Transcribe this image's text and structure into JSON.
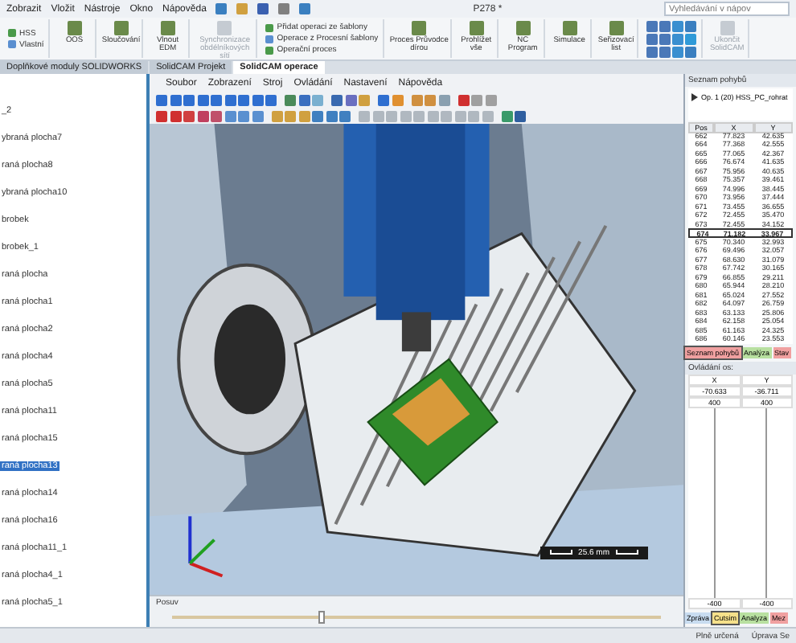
{
  "menu": [
    "Zobrazit",
    "Vložit",
    "Nástroje",
    "Okno",
    "Nápověda"
  ],
  "document_title": "P278 *",
  "help_search": {
    "placeholder": "Vyhledávání v nápov"
  },
  "ribbon": [
    {
      "kind": "stack",
      "items": [
        "HSS",
        "Vlastní"
      ]
    },
    {
      "kind": "large",
      "label": "OOS",
      "disabled": false
    },
    {
      "kind": "large",
      "label": "Sloučování",
      "disabled": false
    },
    {
      "kind": "large",
      "label": "Vlnout EDM",
      "disabled": false
    },
    {
      "kind": "large",
      "label": "Synchronizace obdélníkových sítí",
      "disabled": true
    },
    {
      "kind": "stack",
      "items": [
        "Přidat operaci ze šablony",
        "Operace z Procesní šablony",
        "Operační proces"
      ]
    },
    {
      "kind": "large",
      "label": "Proces Průvodce dírou",
      "disabled": false
    },
    {
      "kind": "large",
      "label": "Prohlížet vše",
      "disabled": false
    },
    {
      "kind": "large",
      "label": "NC Program",
      "disabled": false
    },
    {
      "kind": "large",
      "label": "Simulace",
      "disabled": false
    },
    {
      "kind": "large",
      "label": "Seřizovací list",
      "disabled": false
    },
    {
      "kind": "grid"
    },
    {
      "kind": "large",
      "label": "Ukončit SolidCAM",
      "disabled": true
    }
  ],
  "tabs": [
    {
      "label": "Doplňkové moduly SOLIDWORKS",
      "selected": false
    },
    {
      "label": "SolidCAM Projekt",
      "selected": false
    },
    {
      "label": "SolidCAM operace",
      "selected": true
    }
  ],
  "tree": [
    {
      "label": "_2",
      "selected": false
    },
    {
      "label": "ybraná plocha7",
      "selected": false
    },
    {
      "label": "raná plocha8",
      "selected": false
    },
    {
      "label": "ybraná plocha10",
      "selected": false
    },
    {
      "label": "brobek",
      "selected": false
    },
    {
      "label": "brobek_1",
      "selected": false
    },
    {
      "label": "raná plocha",
      "selected": false
    },
    {
      "label": "raná plocha1",
      "selected": false
    },
    {
      "label": "raná plocha2",
      "selected": false
    },
    {
      "label": "raná plocha4",
      "selected": false
    },
    {
      "label": "raná plocha5",
      "selected": false
    },
    {
      "label": "raná plocha11",
      "selected": false
    },
    {
      "label": "raná plocha15",
      "selected": false
    },
    {
      "label": "raná plocha13",
      "selected": true
    },
    {
      "label": "raná plocha14",
      "selected": false
    },
    {
      "label": "raná plocha16",
      "selected": false
    },
    {
      "label": "raná plocha11_1",
      "selected": false
    },
    {
      "label": "raná plocha4_1",
      "selected": false
    },
    {
      "label": "raná plocha5_1",
      "selected": false
    }
  ],
  "sim": {
    "menu": [
      "Soubor",
      "Zobrazení",
      "Stroj",
      "Ovládání",
      "Nastavení",
      "Nápověda"
    ],
    "scale_label": "25.6 mm",
    "panel_title": "Posuv",
    "feed": {
      "level": 0.3
    }
  },
  "moves": {
    "title": "Seznam pohybů",
    "operation": "Op. 1 (20) HSS_PC_rohrat",
    "columns": [
      "Pos",
      "X",
      "Y"
    ],
    "rows": [
      {
        "cells": [
          "662",
          "77.823",
          "42.635"
        ],
        "selected": false
      },
      {
        "cells": [
          "664",
          "77.368",
          "42.555"
        ],
        "selected": false
      },
      {
        "cells": [
          "665",
          "77.065",
          "42.367"
        ],
        "selected": false
      },
      {
        "cells": [
          "666",
          "76.674",
          "41.635"
        ],
        "selected": false
      },
      {
        "cells": [
          "667",
          "75.956",
          "40.635"
        ],
        "selected": false
      },
      {
        "cells": [
          "668",
          "75.357",
          "39.461"
        ],
        "selected": false
      },
      {
        "cells": [
          "669",
          "74.996",
          "38.445"
        ],
        "selected": false
      },
      {
        "cells": [
          "670",
          "73.956",
          "37.444"
        ],
        "selected": false
      },
      {
        "cells": [
          "671",
          "73.455",
          "36.655"
        ],
        "selected": false
      },
      {
        "cells": [
          "672",
          "72.455",
          "35.470"
        ],
        "selected": false
      },
      {
        "cells": [
          "673",
          "72.455",
          "34.152"
        ],
        "selected": false
      },
      {
        "cells": [
          "674",
          "71.182",
          "33.967"
        ],
        "selected": true
      },
      {
        "cells": [
          "675",
          "70.340",
          "32.993"
        ],
        "selected": false
      },
      {
        "cells": [
          "676",
          "69.496",
          "32.057"
        ],
        "selected": false
      },
      {
        "cells": [
          "677",
          "68.630",
          "31.079"
        ],
        "selected": false
      },
      {
        "cells": [
          "678",
          "67.742",
          "30.165"
        ],
        "selected": false
      },
      {
        "cells": [
          "679",
          "66.855",
          "29.211"
        ],
        "selected": false
      },
      {
        "cells": [
          "680",
          "65.944",
          "28.210"
        ],
        "selected": false
      },
      {
        "cells": [
          "681",
          "65.024",
          "27.552"
        ],
        "selected": false
      },
      {
        "cells": [
          "682",
          "64.097",
          "26.759"
        ],
        "selected": false
      },
      {
        "cells": [
          "683",
          "63.133",
          "25.806"
        ],
        "selected": false
      },
      {
        "cells": [
          "684",
          "62.158",
          "25.054"
        ],
        "selected": false
      },
      {
        "cells": [
          "685",
          "61.163",
          "24.325"
        ],
        "selected": false
      },
      {
        "cells": [
          "686",
          "60.146",
          "23.553"
        ],
        "selected": false
      }
    ],
    "tabs": [
      {
        "label": "Seznam pohybů",
        "color": "#f0a0a0",
        "selected": true
      },
      {
        "label": "Analýza",
        "color": "#b8e0a0",
        "selected": false
      },
      {
        "label": "Stav",
        "color": "#f0a0a0",
        "selected": false
      }
    ],
    "axis_title": "Ovládání os:",
    "axis_columns": [
      "X",
      "Y"
    ],
    "axis_values": [
      "-70.633",
      "-36.711"
    ],
    "axis_max": [
      "400",
      "400"
    ],
    "axis_min": [
      "-400",
      "-400"
    ],
    "bottom_tabs": [
      {
        "label": "Zpráva",
        "color": "#c8dcf0",
        "selected": false
      },
      {
        "label": "Cutsim",
        "color": "#f5e08a",
        "selected": true
      },
      {
        "label": "Analyza",
        "color": "#b8e0a0",
        "selected": false
      },
      {
        "label": "Mez",
        "color": "#f0a0a0",
        "selected": false
      }
    ]
  },
  "status": [
    "Plně určená",
    "Úprava Se"
  ]
}
